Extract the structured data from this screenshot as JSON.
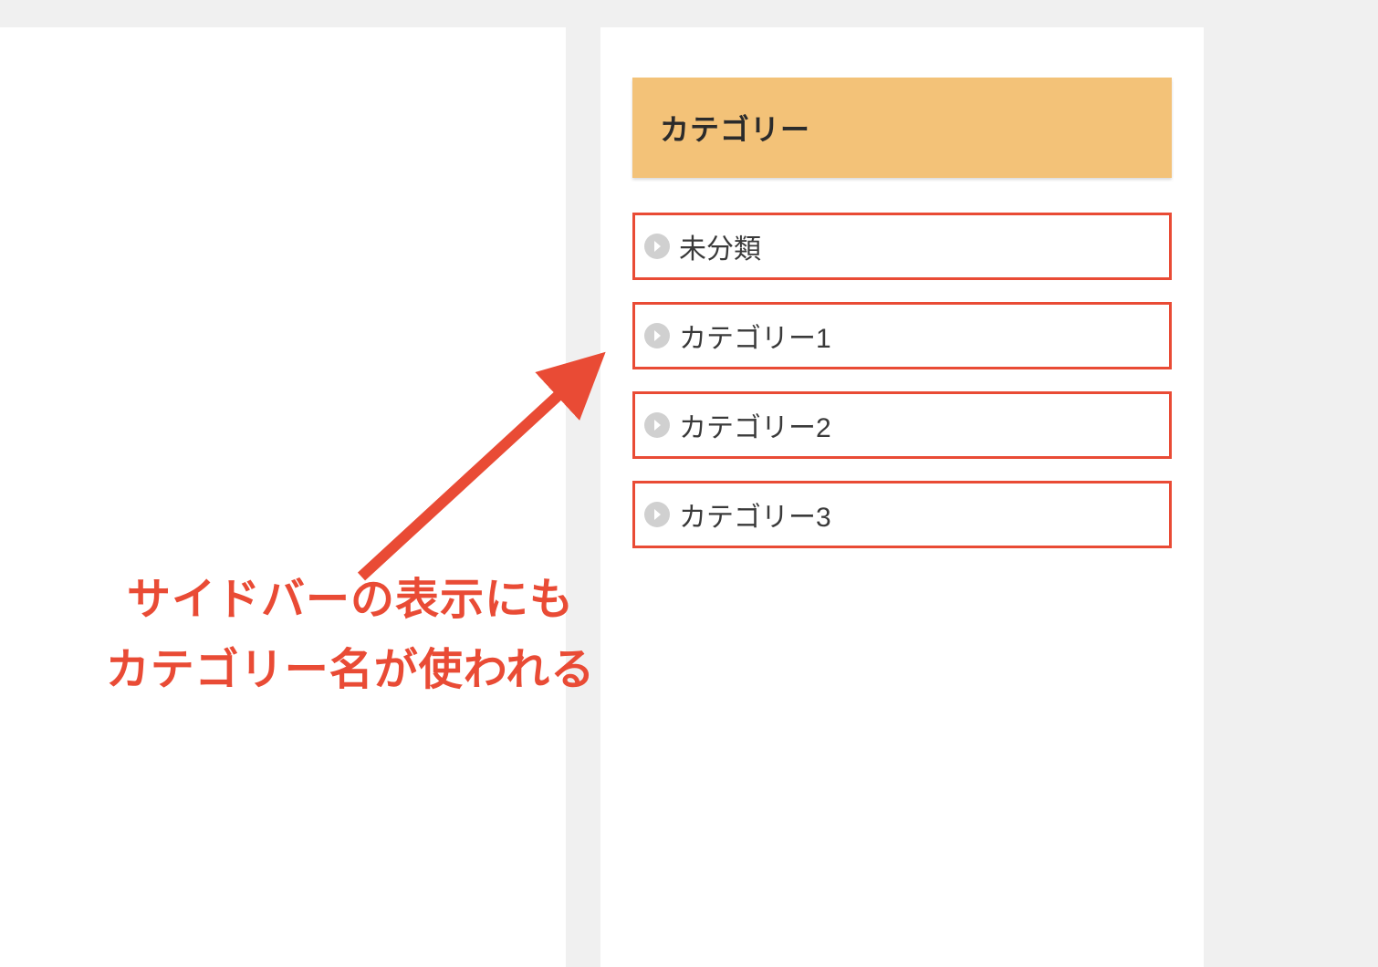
{
  "sidebar": {
    "title": "カテゴリー",
    "items": [
      {
        "label": "未分類"
      },
      {
        "label": "カテゴリー1"
      },
      {
        "label": "カテゴリー2"
      },
      {
        "label": "カテゴリー3"
      }
    ]
  },
  "annotation": {
    "line1": "サイドバーの表示にも",
    "line2": "カテゴリー名が使われる"
  },
  "colors": {
    "highlight": "#e94b35",
    "header_bg": "#f3c278",
    "page_bg": "#f0f0f0",
    "panel_bg": "#ffffff"
  }
}
